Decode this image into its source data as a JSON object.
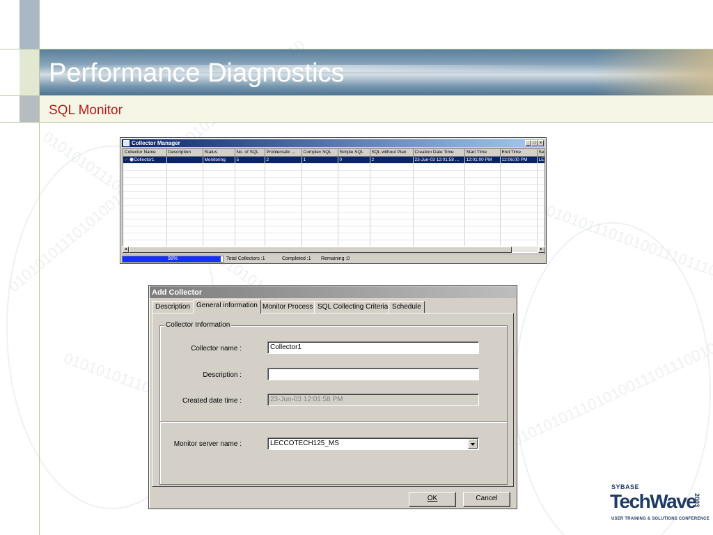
{
  "slide": {
    "title": "Performance Diagnostics",
    "subtitle": "SQL Monitor"
  },
  "collector_manager": {
    "title": "Collector Manager",
    "window_buttons": [
      "_",
      "□",
      "×"
    ],
    "columns": [
      "Collector Name",
      "Description",
      "Status",
      "No. of SQL",
      "Problematic ...",
      "Complex SQL",
      "Simple SQL",
      "SQL without Plan",
      "Creation Date Time",
      "Start Time",
      "End Time",
      "Se"
    ],
    "rows": [
      {
        "check": "✓",
        "name": "Collector1",
        "description": "",
        "status": "Monitoring",
        "no_of_sql": "5",
        "problematic": "2",
        "complex_sql": "1",
        "simple_sql": "0",
        "sql_without_plan": "2",
        "creation_date_time": "23-Jun-03 12:01:58 ...",
        "start_time": "12:01:00 PM",
        "end_time": "12:06:00 PM",
        "server": "LE"
      }
    ],
    "progress_fraction": 0.98,
    "progress_label": "98%",
    "status": {
      "total": "Total Collectors :1",
      "completed": "Completed :1",
      "remaining": "Remaining :0"
    }
  },
  "add_collector": {
    "title": "Add Collector",
    "tabs": [
      "Description",
      "General information",
      "Monitor Process",
      "SQL Collecting Criteria",
      "Schedule"
    ],
    "active_tab": "General information",
    "group_label": "Collector Information",
    "fields": {
      "collector_name_label": "Collector name :",
      "collector_name_value": "Collector1",
      "description_label": "Description :",
      "description_value": "",
      "created_label": "Created date time :",
      "created_value": "23-Jun-03 12:01:58 PM",
      "server_label": "Monitor server name :",
      "server_value": "LECCOTECH125_MS"
    },
    "buttons": {
      "ok": "OK",
      "cancel": "Cancel"
    }
  },
  "logo": {
    "sybase": "SYBASE",
    "name": "TechWave",
    "year": "2003",
    "tagline": "USER TRAINING & SOLUTIONS CONFERENCE"
  },
  "watermark_digits": "0101010111010100111011100101010110101010111010"
}
